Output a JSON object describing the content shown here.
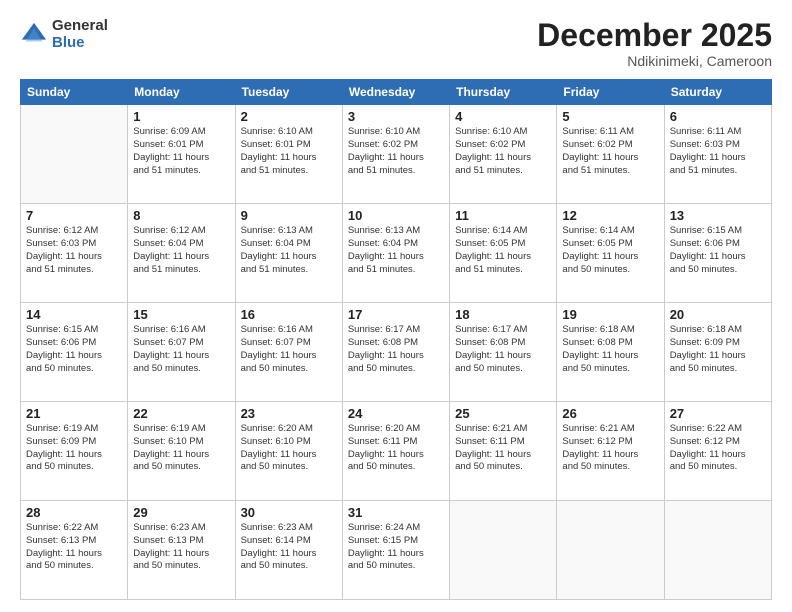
{
  "header": {
    "logo_general": "General",
    "logo_blue": "Blue",
    "month_title": "December 2025",
    "location": "Ndikinimeki, Cameroon"
  },
  "calendar": {
    "weekdays": [
      "Sunday",
      "Monday",
      "Tuesday",
      "Wednesday",
      "Thursday",
      "Friday",
      "Saturday"
    ],
    "weeks": [
      [
        {
          "day": "",
          "info": ""
        },
        {
          "day": "1",
          "info": "Sunrise: 6:09 AM\nSunset: 6:01 PM\nDaylight: 11 hours\nand 51 minutes."
        },
        {
          "day": "2",
          "info": "Sunrise: 6:10 AM\nSunset: 6:01 PM\nDaylight: 11 hours\nand 51 minutes."
        },
        {
          "day": "3",
          "info": "Sunrise: 6:10 AM\nSunset: 6:02 PM\nDaylight: 11 hours\nand 51 minutes."
        },
        {
          "day": "4",
          "info": "Sunrise: 6:10 AM\nSunset: 6:02 PM\nDaylight: 11 hours\nand 51 minutes."
        },
        {
          "day": "5",
          "info": "Sunrise: 6:11 AM\nSunset: 6:02 PM\nDaylight: 11 hours\nand 51 minutes."
        },
        {
          "day": "6",
          "info": "Sunrise: 6:11 AM\nSunset: 6:03 PM\nDaylight: 11 hours\nand 51 minutes."
        }
      ],
      [
        {
          "day": "7",
          "info": "Sunrise: 6:12 AM\nSunset: 6:03 PM\nDaylight: 11 hours\nand 51 minutes."
        },
        {
          "day": "8",
          "info": "Sunrise: 6:12 AM\nSunset: 6:04 PM\nDaylight: 11 hours\nand 51 minutes."
        },
        {
          "day": "9",
          "info": "Sunrise: 6:13 AM\nSunset: 6:04 PM\nDaylight: 11 hours\nand 51 minutes."
        },
        {
          "day": "10",
          "info": "Sunrise: 6:13 AM\nSunset: 6:04 PM\nDaylight: 11 hours\nand 51 minutes."
        },
        {
          "day": "11",
          "info": "Sunrise: 6:14 AM\nSunset: 6:05 PM\nDaylight: 11 hours\nand 51 minutes."
        },
        {
          "day": "12",
          "info": "Sunrise: 6:14 AM\nSunset: 6:05 PM\nDaylight: 11 hours\nand 50 minutes."
        },
        {
          "day": "13",
          "info": "Sunrise: 6:15 AM\nSunset: 6:06 PM\nDaylight: 11 hours\nand 50 minutes."
        }
      ],
      [
        {
          "day": "14",
          "info": "Sunrise: 6:15 AM\nSunset: 6:06 PM\nDaylight: 11 hours\nand 50 minutes."
        },
        {
          "day": "15",
          "info": "Sunrise: 6:16 AM\nSunset: 6:07 PM\nDaylight: 11 hours\nand 50 minutes."
        },
        {
          "day": "16",
          "info": "Sunrise: 6:16 AM\nSunset: 6:07 PM\nDaylight: 11 hours\nand 50 minutes."
        },
        {
          "day": "17",
          "info": "Sunrise: 6:17 AM\nSunset: 6:08 PM\nDaylight: 11 hours\nand 50 minutes."
        },
        {
          "day": "18",
          "info": "Sunrise: 6:17 AM\nSunset: 6:08 PM\nDaylight: 11 hours\nand 50 minutes."
        },
        {
          "day": "19",
          "info": "Sunrise: 6:18 AM\nSunset: 6:08 PM\nDaylight: 11 hours\nand 50 minutes."
        },
        {
          "day": "20",
          "info": "Sunrise: 6:18 AM\nSunset: 6:09 PM\nDaylight: 11 hours\nand 50 minutes."
        }
      ],
      [
        {
          "day": "21",
          "info": "Sunrise: 6:19 AM\nSunset: 6:09 PM\nDaylight: 11 hours\nand 50 minutes."
        },
        {
          "day": "22",
          "info": "Sunrise: 6:19 AM\nSunset: 6:10 PM\nDaylight: 11 hours\nand 50 minutes."
        },
        {
          "day": "23",
          "info": "Sunrise: 6:20 AM\nSunset: 6:10 PM\nDaylight: 11 hours\nand 50 minutes."
        },
        {
          "day": "24",
          "info": "Sunrise: 6:20 AM\nSunset: 6:11 PM\nDaylight: 11 hours\nand 50 minutes."
        },
        {
          "day": "25",
          "info": "Sunrise: 6:21 AM\nSunset: 6:11 PM\nDaylight: 11 hours\nand 50 minutes."
        },
        {
          "day": "26",
          "info": "Sunrise: 6:21 AM\nSunset: 6:12 PM\nDaylight: 11 hours\nand 50 minutes."
        },
        {
          "day": "27",
          "info": "Sunrise: 6:22 AM\nSunset: 6:12 PM\nDaylight: 11 hours\nand 50 minutes."
        }
      ],
      [
        {
          "day": "28",
          "info": "Sunrise: 6:22 AM\nSunset: 6:13 PM\nDaylight: 11 hours\nand 50 minutes."
        },
        {
          "day": "29",
          "info": "Sunrise: 6:23 AM\nSunset: 6:13 PM\nDaylight: 11 hours\nand 50 minutes."
        },
        {
          "day": "30",
          "info": "Sunrise: 6:23 AM\nSunset: 6:14 PM\nDaylight: 11 hours\nand 50 minutes."
        },
        {
          "day": "31",
          "info": "Sunrise: 6:24 AM\nSunset: 6:15 PM\nDaylight: 11 hours\nand 50 minutes."
        },
        {
          "day": "",
          "info": ""
        },
        {
          "day": "",
          "info": ""
        },
        {
          "day": "",
          "info": ""
        }
      ]
    ]
  }
}
